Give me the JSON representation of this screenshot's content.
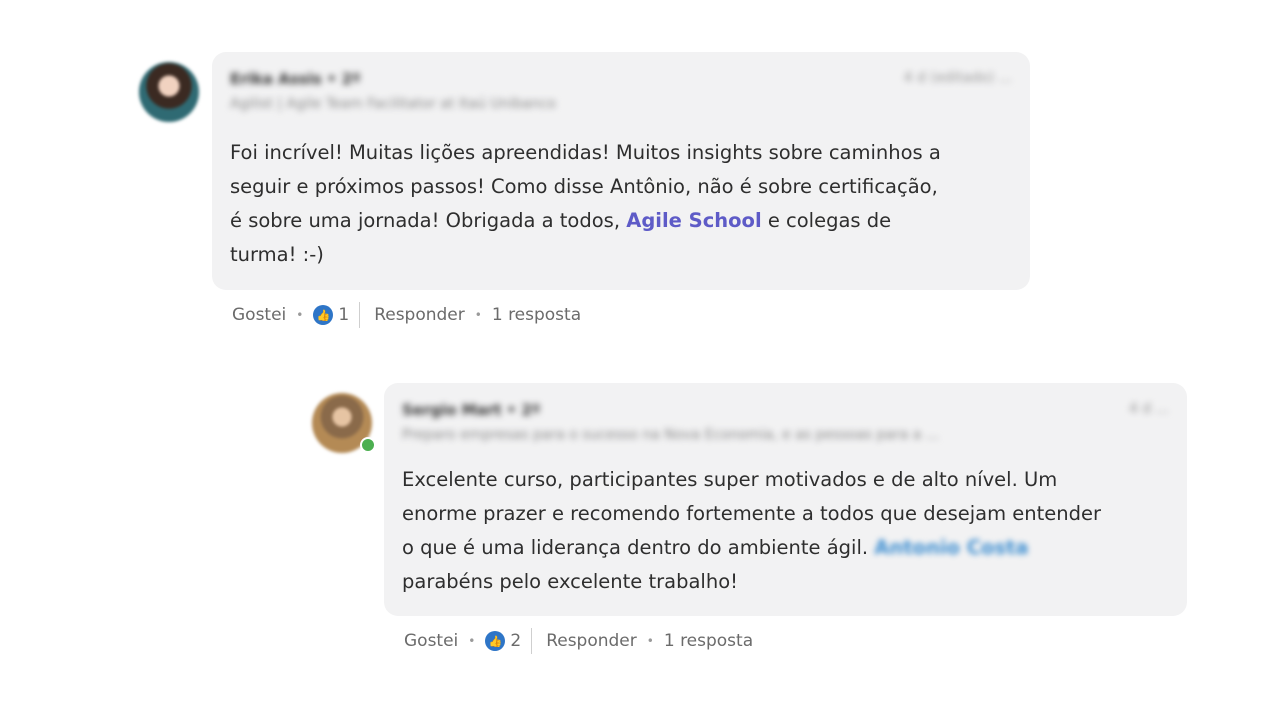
{
  "comments": [
    {
      "author_name": "Erika Assis • 2º",
      "author_headline": "Agilist | Agile Team Facilitator at Itaú Unibanco",
      "meta": "4 d (editado) ...",
      "text_lines": [
        "Foi incrível! Muitas lições apreendidas! Muitos insights sobre caminhos a",
        "seguir e próximos passos! Como disse Antônio, não é sobre certificação,",
        "é sobre uma jornada! Obrigada a todos, ",
        "turma! :-)"
      ],
      "mention": "Agile School",
      "line3_suffix": " e colegas de",
      "actions": {
        "like_label": "Gostei",
        "like_count": "1",
        "reply_label": "Responder",
        "replies": "1 resposta"
      }
    },
    {
      "author_name": "Sergio Mart • 2º",
      "author_headline": "Preparo empresas para o sucesso na Nova Economia, e as pessoas para a ...",
      "meta": "4 d ...",
      "text_lines": [
        "Excelente curso, participantes super motivados e de alto nível. Um",
        "enorme prazer e recomendo fortemente a todos que desejam entender",
        "o que é uma liderança dentro do ambiente ágil. ",
        "parabéns pelo excelente trabalho!"
      ],
      "mention": "Antonio Costa",
      "actions": {
        "like_label": "Gostei",
        "like_count": "2",
        "reply_label": "Responder",
        "replies": "1 resposta"
      }
    }
  ],
  "icons": {
    "like_badge": "thumbs-up-icon"
  },
  "colors": {
    "bubble_bg": "#f2f2f3",
    "mention": "#5e5bc7",
    "like_badge": "#2e75c7"
  }
}
